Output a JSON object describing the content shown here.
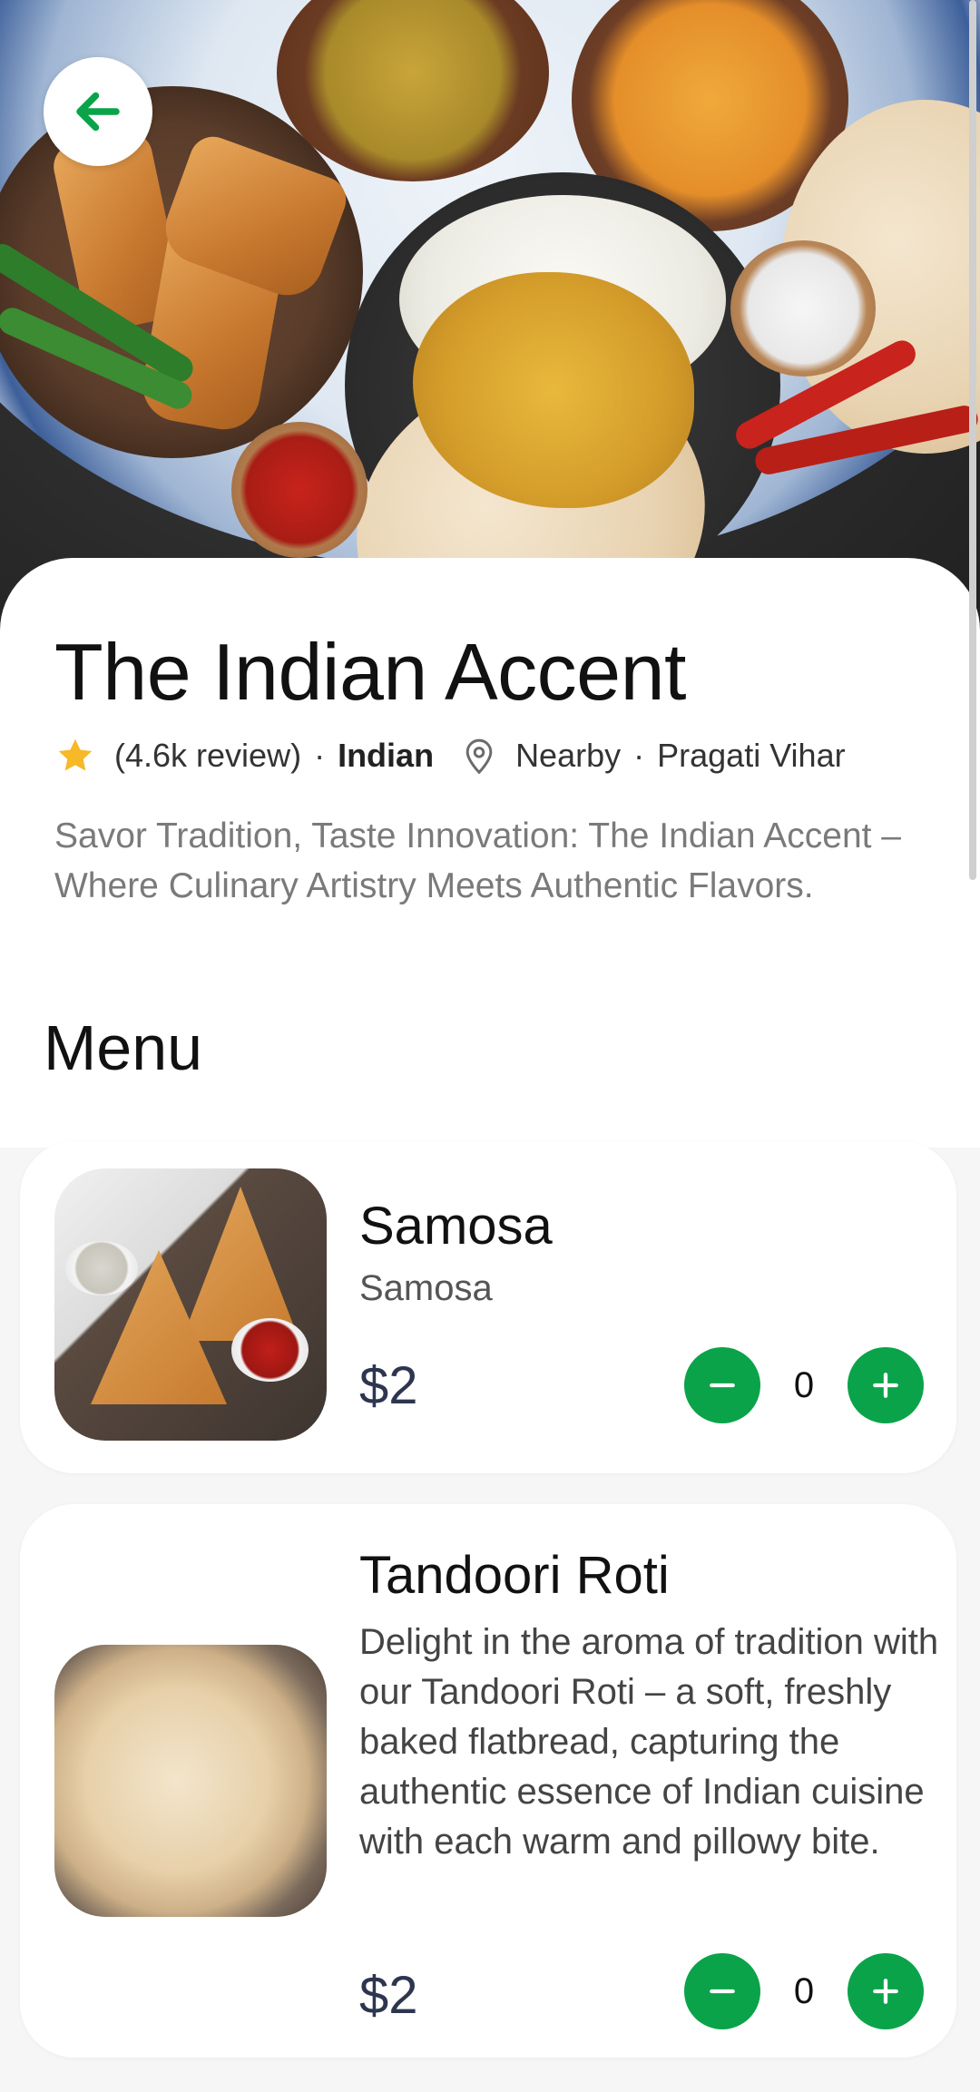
{
  "hero": {
    "image": "indian-food-platter"
  },
  "back_button": {
    "icon": "arrow-left-icon",
    "color": "#0aa34a"
  },
  "restaurant": {
    "name": "The Indian Accent",
    "rating_icon": "star-icon",
    "reviews": "(4.6k review)",
    "separator": "·",
    "cuisine": "Indian",
    "location_icon": "location-pin-icon",
    "distance": "Nearby",
    "area": "Pragati Vihar",
    "description": "Savor Tradition, Taste Innovation: The Indian Accent – Where Culinary Artistry Meets Authentic Flavors."
  },
  "menu": {
    "heading": "Menu",
    "items": [
      {
        "name": "Samosa",
        "subtitle": "Samosa",
        "price": "$2",
        "quantity": "0",
        "image": "samosa-photo"
      },
      {
        "name": "Tandoori Roti",
        "description": "Delight in the aroma of tradition with our Tandoori Roti – a soft, freshly baked flatbread, capturing the authentic essence of Indian cuisine with each warm and pillowy bite.",
        "price": "$2",
        "quantity": "0",
        "image": "tandoori-roti-photo"
      }
    ]
  },
  "colors": {
    "accent": "#0aa34a",
    "star": "#f7b928",
    "price": "#2e3550"
  }
}
